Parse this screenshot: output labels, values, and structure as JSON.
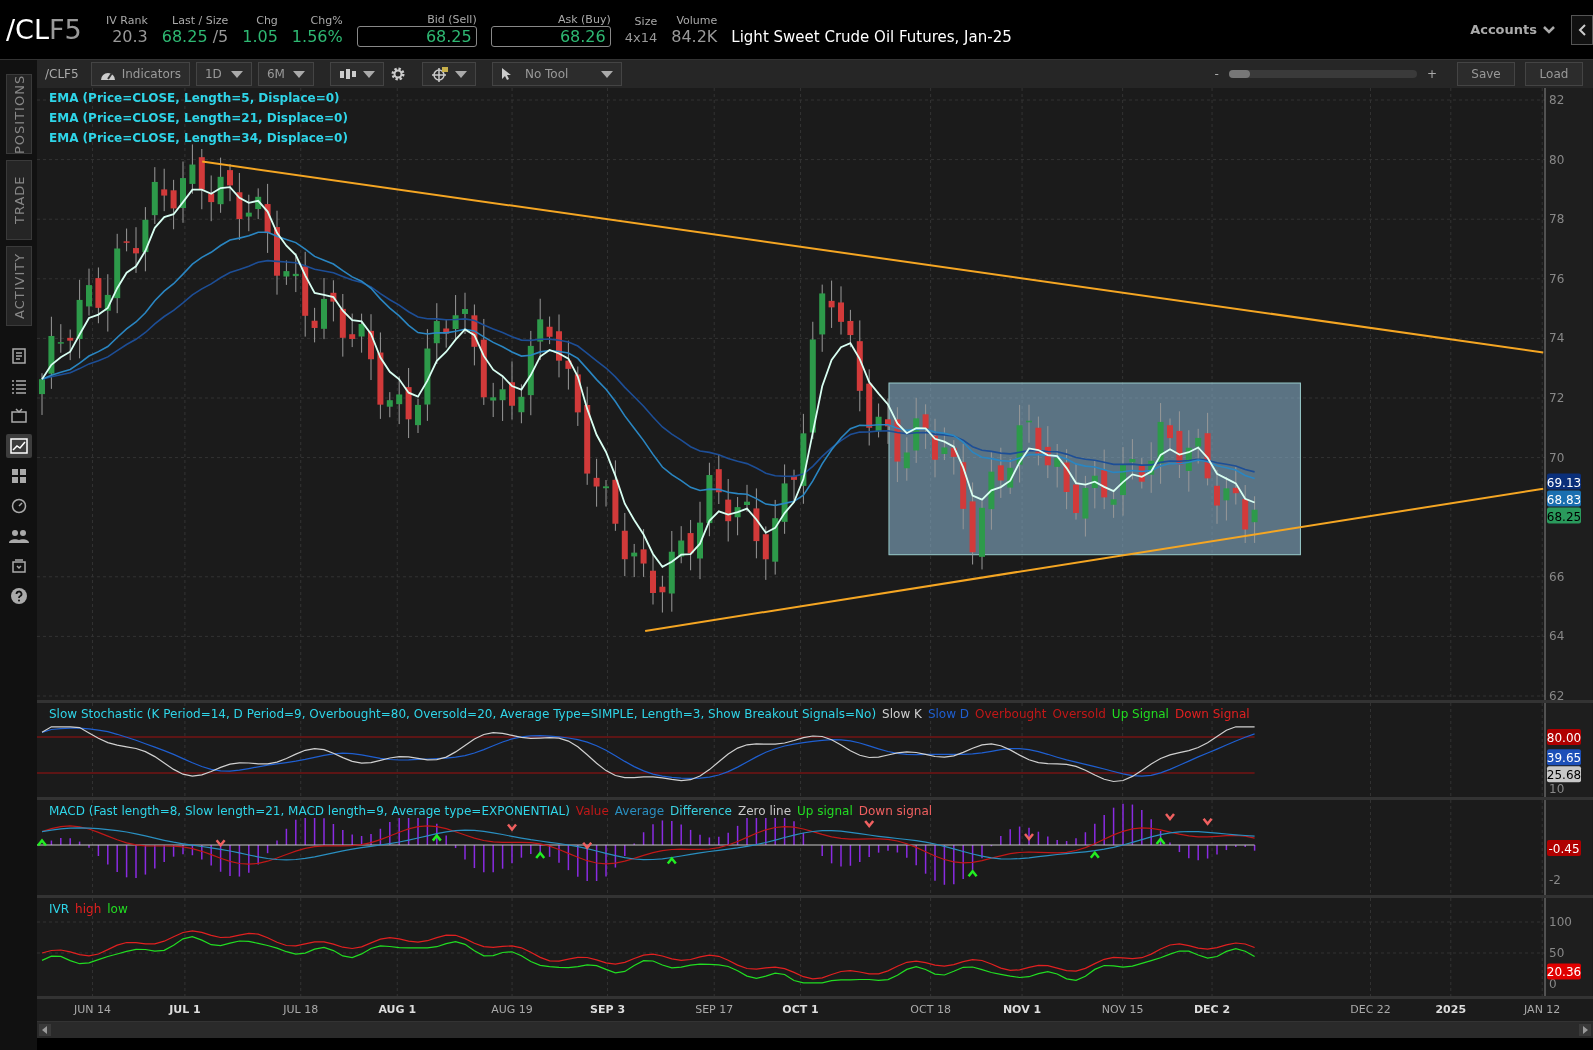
{
  "header": {
    "symbol_root": "/CL",
    "symbol_suffix": "F5",
    "fields": [
      {
        "label": "IV Rank",
        "value": "20.3",
        "kind": "plain"
      },
      {
        "label": "Last / Size",
        "value": "68.25",
        "extra": "/5",
        "kind": "last"
      },
      {
        "label": "Chg",
        "value": "1.05",
        "kind": "up"
      },
      {
        "label": "Chg%",
        "value": "1.56%",
        "kind": "up"
      },
      {
        "label": "Bid (Sell)",
        "value": "68.25",
        "kind": "boxed"
      },
      {
        "label": "Ask (Buy)",
        "value": "68.26",
        "kind": "boxed"
      },
      {
        "label": "Size",
        "value": "4x14",
        "kind": "small"
      },
      {
        "label": "Volume",
        "value": "84.2K",
        "kind": "plain"
      }
    ],
    "description": "Light Sweet Crude Oil Futures, Jan-25",
    "accounts": "Accounts"
  },
  "sidebar": {
    "tabs": [
      {
        "label": "POSITIONS",
        "selected": false
      },
      {
        "label": "TRADE",
        "selected": false
      },
      {
        "label": "ACTIVITY",
        "selected": false
      }
    ],
    "icons": [
      {
        "kind": "document",
        "selected": false
      },
      {
        "kind": "list",
        "selected": false
      },
      {
        "kind": "monitor",
        "selected": false
      },
      {
        "kind": "chart",
        "selected": true
      },
      {
        "kind": "grid",
        "selected": false
      },
      {
        "kind": "gauge",
        "selected": false
      },
      {
        "kind": "people",
        "selected": false
      },
      {
        "kind": "stack",
        "selected": false
      },
      {
        "kind": "help",
        "selected": false
      }
    ]
  },
  "toolbar": {
    "symbol": "/CLF5",
    "indicators": "Indicators",
    "aggregation": "1D",
    "range": "6M",
    "tool": "No Tool",
    "zoom_minus": "-",
    "zoom_plus": "+",
    "zoom": {
      "level": 0.11
    },
    "save": "Save",
    "load": "Load"
  },
  "price_panel": {
    "studies": [
      "EMA (Price=CLOSE, Length=5, Displace=0)",
      "EMA (Price=CLOSE, Length=21, Displace=0)",
      "EMA (Price=CLOSE, Length=34, Displace=0)"
    ],
    "y_ticks": [
      "82",
      "80",
      "78",
      "76",
      "74",
      "72",
      "70",
      "66",
      "64",
      "62"
    ],
    "badges": [
      {
        "text": "69.13",
        "color": "#0a2f7a"
      },
      {
        "text": "68.83",
        "color": "#1a6fb0"
      },
      {
        "text": "68.25",
        "color": "#2a9a5c"
      }
    ]
  },
  "stochastic_panel": {
    "title": "Slow Stochastic (K Period=14, D Period=9, Overbought=80, Oversold=20, Average Type=SIMPLE, Length=3, Show Breakout Signals=No)",
    "legend": [
      {
        "text": "Slow K",
        "color": "#d0d0d0"
      },
      {
        "text": "Slow D",
        "color": "#1f5fd0"
      },
      {
        "text": "Overbought",
        "color": "#c01818"
      },
      {
        "text": "Oversold",
        "color": "#c01818"
      },
      {
        "text": "Up Signal",
        "color": "#22dd22"
      },
      {
        "text": "Down Signal",
        "color": "#e02020"
      }
    ],
    "y_ticks": [
      "10"
    ],
    "badges": [
      {
        "text": "80.00",
        "color": "#b00000"
      },
      {
        "text": "39.65",
        "color": "#1c4fb8"
      },
      {
        "text": "25.68",
        "color": "#c8c8c8"
      }
    ]
  },
  "macd_panel": {
    "title": "MACD (Fast length=8, Slow length=21, MACD length=9, Average type=EXPONENTIAL)",
    "legend": [
      {
        "text": "Value",
        "color": "#c01818"
      },
      {
        "text": "Average",
        "color": "#2a8fc0"
      },
      {
        "text": "Difference",
        "color": "#3ad0e0"
      },
      {
        "text": "Zero line",
        "color": "#c8c8c8"
      },
      {
        "text": "Up signal",
        "color": "#22dd22"
      },
      {
        "text": "Down signal",
        "color": "#f06060"
      }
    ],
    "y_ticks": [
      "-2"
    ],
    "badges": [
      {
        "text": "-0.45",
        "color": "#b00000"
      }
    ]
  },
  "ivr_panel": {
    "title": "IVR",
    "legend": [
      {
        "text": "high",
        "color": "#e02020"
      },
      {
        "text": "low",
        "color": "#22dd22"
      }
    ],
    "y_ticks": [
      "100",
      "50",
      "0"
    ],
    "badges": [
      {
        "text": "20.36",
        "color": "#e00000"
      }
    ]
  },
  "x_axis": [
    {
      "text": "JUN 14",
      "bold": false
    },
    {
      "text": "JUL 1",
      "bold": true
    },
    {
      "text": "JUL 18",
      "bold": false
    },
    {
      "text": "AUG 1",
      "bold": true
    },
    {
      "text": "AUG 19",
      "bold": false
    },
    {
      "text": "SEP 3",
      "bold": true
    },
    {
      "text": "SEP 17",
      "bold": false
    },
    {
      "text": "OCT 1",
      "bold": true
    },
    {
      "text": "OCT 18",
      "bold": false
    },
    {
      "text": "NOV 1",
      "bold": true
    },
    {
      "text": "NOV 15",
      "bold": false
    },
    {
      "text": "DEC 2",
      "bold": true
    },
    {
      "text": "DEC 22",
      "bold": false
    },
    {
      "text": "2025",
      "bold": true
    },
    {
      "text": "JAN 12",
      "bold": false
    }
  ]
}
